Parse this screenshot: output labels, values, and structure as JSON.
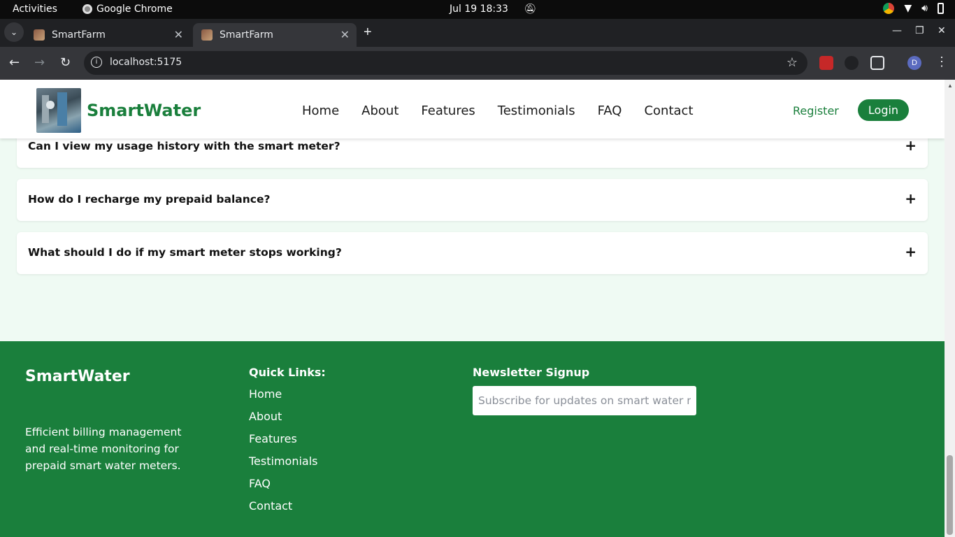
{
  "system": {
    "activities": "Activities",
    "app_name": "Google Chrome",
    "clock": "Jul 19  18:33"
  },
  "browser": {
    "tabs": [
      {
        "title": "SmartFarm"
      },
      {
        "title": "SmartFarm"
      }
    ],
    "url": "localhost:5175",
    "profile_initial": "D"
  },
  "site": {
    "brand": "SmartWater",
    "nav": [
      {
        "label": "Home"
      },
      {
        "label": "About"
      },
      {
        "label": "Features"
      },
      {
        "label": "Testimonials"
      },
      {
        "label": "FAQ"
      },
      {
        "label": "Contact"
      }
    ],
    "register_label": "Register",
    "login_label": "Login"
  },
  "faq": [
    {
      "question": "Can I view my usage history with the smart meter?",
      "toggle": "+"
    },
    {
      "question": "How do I recharge my prepaid balance?",
      "toggle": "+"
    },
    {
      "question": "What should I do if my smart meter stops working?",
      "toggle": "+"
    }
  ],
  "footer": {
    "brand": "SmartWater",
    "description": "Efficient billing management and real-time monitoring for prepaid smart water meters.",
    "quick_links_title": "Quick Links:",
    "quick_links": [
      {
        "label": "Home"
      },
      {
        "label": "About"
      },
      {
        "label": "Features"
      },
      {
        "label": "Testimonials"
      },
      {
        "label": "FAQ"
      },
      {
        "label": "Contact"
      }
    ],
    "newsletter_title": "Newsletter Signup",
    "newsletter_placeholder": "Subscribe for updates on smart water management"
  },
  "colors": {
    "brand_green": "#1a7f3c",
    "page_bg": "#effaf3"
  }
}
